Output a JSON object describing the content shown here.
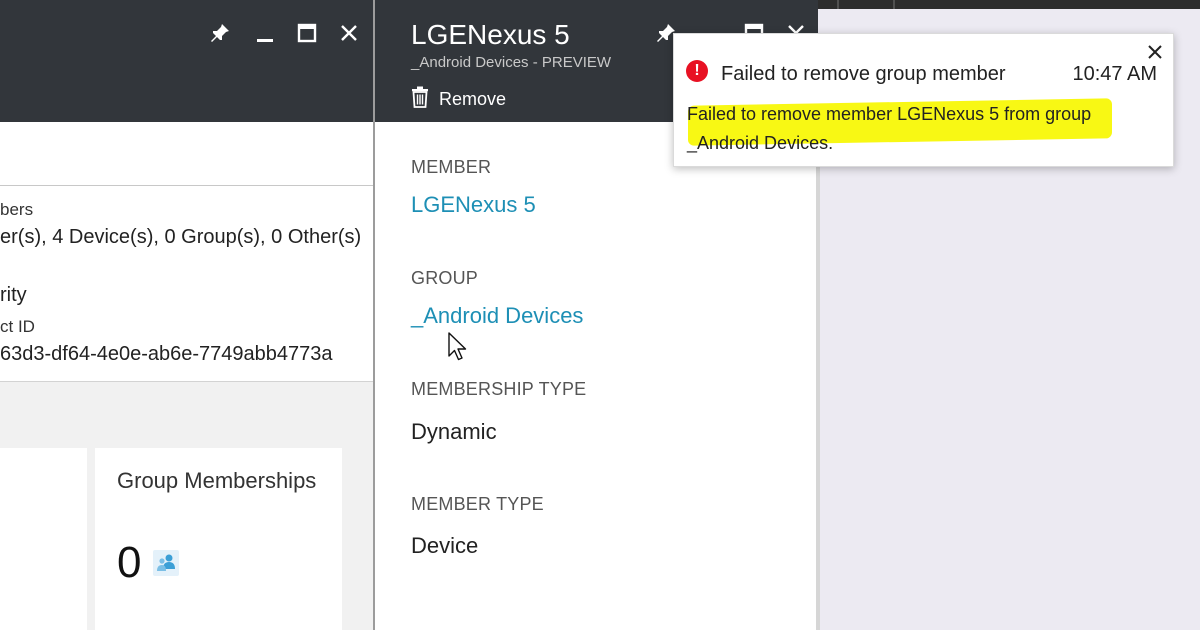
{
  "left_blade": {
    "header_icons": [
      "pin-icon",
      "minimize-icon",
      "maximize-icon",
      "close-icon"
    ],
    "essentials": {
      "members_label": "bers",
      "members_value": "er(s), 4 Device(s), 0 Group(s), 0 Other(s)",
      "type_value": "rity",
      "object_id_label": "ct ID",
      "object_id_value": "63d3-df64-4e0e-ab6e-7749abb4773a"
    },
    "tiles": [
      {
        "title": "",
        "count": ""
      },
      {
        "title": "Group Memberships",
        "count": "0",
        "icon": "group-icon"
      }
    ]
  },
  "member_blade": {
    "title": "LGENexus 5",
    "subtitle": "_Android Devices - PREVIEW",
    "command": {
      "label": "Remove",
      "icon": "trash-icon"
    },
    "header_icons": [
      "pin-icon",
      "maximize-icon",
      "close-icon"
    ],
    "properties": [
      {
        "label": "MEMBER",
        "value": "LGENexus 5",
        "is_link": true
      },
      {
        "label": "GROUP",
        "value": "_Android Devices",
        "is_link": true
      },
      {
        "label": "MEMBERSHIP TYPE",
        "value": "Dynamic",
        "is_link": false
      },
      {
        "label": "MEMBER TYPE",
        "value": "Device",
        "is_link": false
      }
    ]
  },
  "notification": {
    "icon": "error-icon",
    "icon_glyph": "!",
    "title": "Failed to remove group member",
    "time": "10:47 AM",
    "message": "Failed to remove member LGENexus 5 from group _Android Devices.",
    "highlight_color": "#f7f700"
  },
  "colors": {
    "header_bg": "#32363b",
    "link": "#1d8fb5",
    "error": "#e81123"
  }
}
